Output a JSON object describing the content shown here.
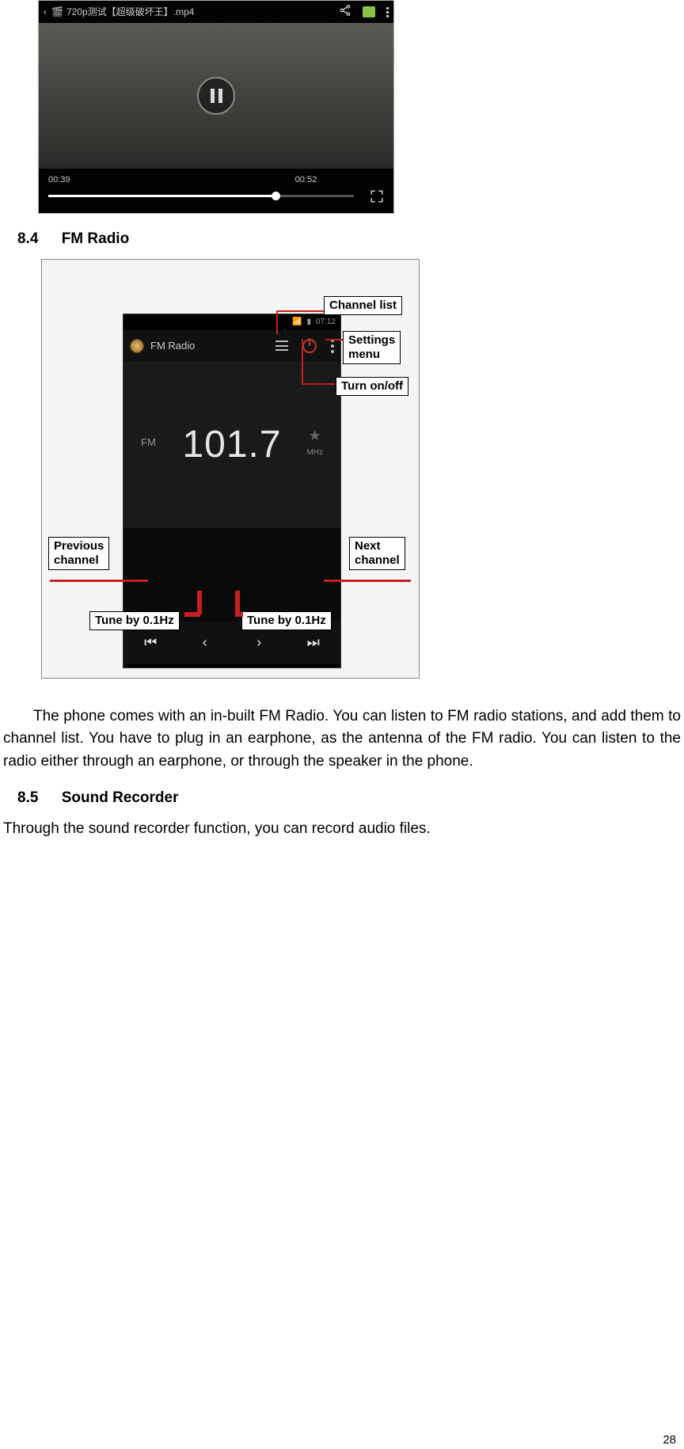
{
  "videoPlayer": {
    "title": "720p测试【超级破坏王】.mp4",
    "currentTime": "00:39",
    "duration": "00:52"
  },
  "sections": {
    "s84": {
      "num": "8.4",
      "title": "FM Radio"
    },
    "s85": {
      "num": "8.5",
      "title": "Sound Recorder"
    }
  },
  "fmRadio": {
    "statusTime": "07:12",
    "appName": "FM Radio",
    "bandLabel": "FM",
    "frequency": "101.7",
    "unit": "MHz"
  },
  "callouts": {
    "channelList": "Channel list",
    "settingsMenu": "Settings menu",
    "turnOnOff": "Turn on/off",
    "prevChannel": "Previous channel",
    "nextChannel": "Next channel",
    "tuneLeft": "Tune by 0.1Hz",
    "tuneRight": "Tune by 0.1Hz"
  },
  "paragraphs": {
    "fmText": "The phone comes with an in-built FM Radio. You can listen to FM radio stations, and add them to channel list. You have to plug in an earphone, as the antenna of the FM radio. You can listen to the radio either through an earphone, or through the speaker in the phone.",
    "recorderText": "Through the sound recorder function, you can record audio files."
  },
  "pageNumber": "28"
}
